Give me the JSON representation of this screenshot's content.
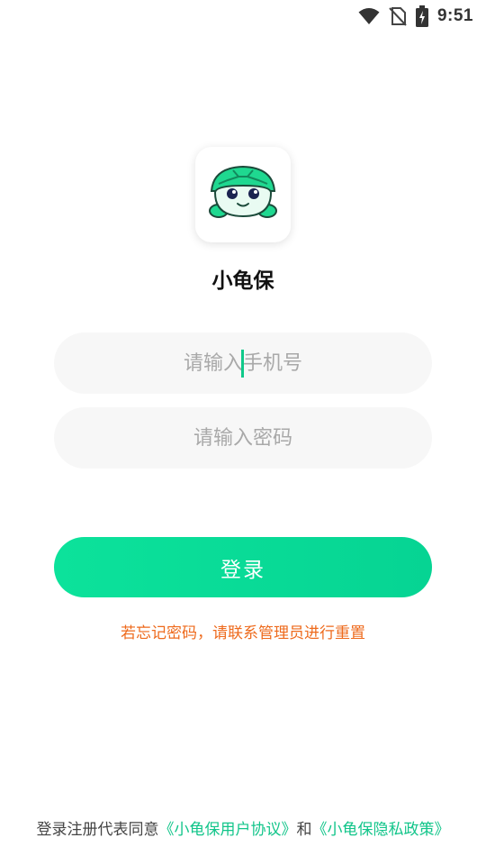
{
  "status_bar": {
    "time": "9:51",
    "icons": [
      "wifi-icon",
      "no-sim-icon",
      "battery-charging-icon"
    ]
  },
  "app": {
    "name": "小龟保",
    "logo_icon": "turtle-logo-icon"
  },
  "login_form": {
    "phone_placeholder": "请输入手机号",
    "password_placeholder": "请输入密码",
    "login_label": "登录"
  },
  "forgot_tip": "若忘记密码，请联系管理员进行重置",
  "agreement": {
    "prefix": "登录注册代表同意",
    "user_agreement": "《小龟保用户协议》",
    "conjunction": "和",
    "privacy_policy": "《小龟保隐私政策》"
  },
  "colors": {
    "accent": "#0ce29b",
    "warning_text": "#ee6a1c",
    "link": "#12c58a",
    "input_bg": "#f7f7f7"
  }
}
